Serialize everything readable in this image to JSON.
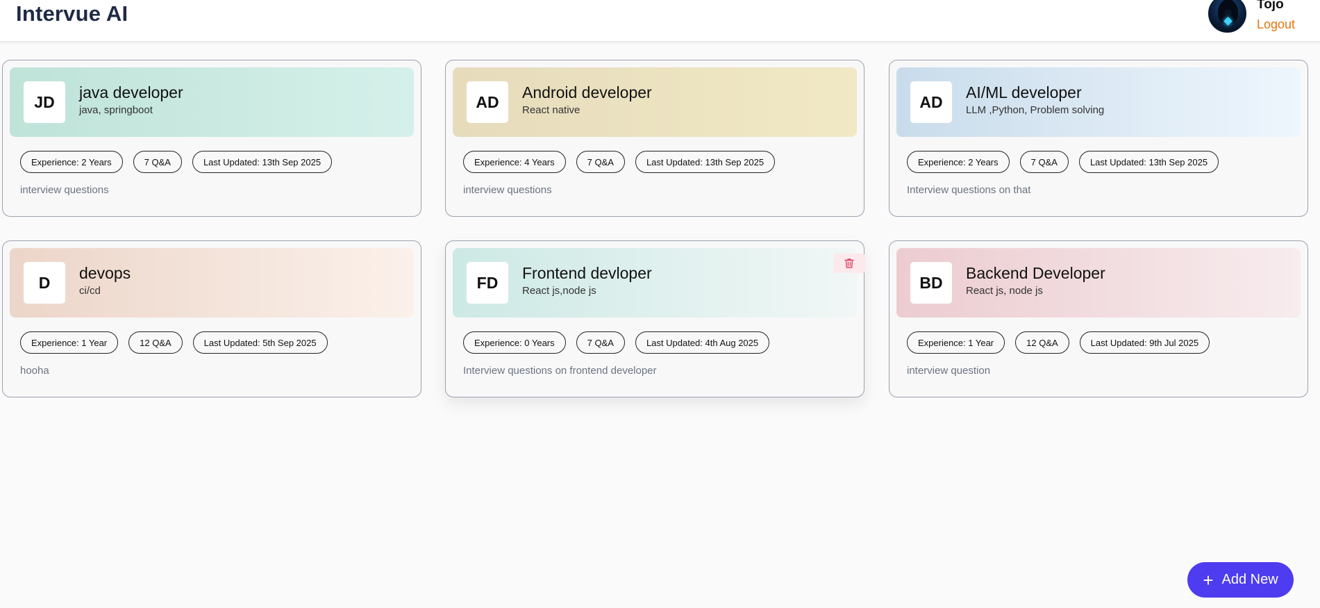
{
  "header": {
    "app_title": "Intervue AI",
    "user_name": "Tojo",
    "logout_label": "Logout"
  },
  "cards": [
    {
      "initials": "JD",
      "title": "java developer",
      "skills": "java, springboot",
      "experience": "Experience: 2 Years",
      "qa": "7 Q&A",
      "updated": "Last Updated: 13th Sep 2025",
      "description": "interview questions",
      "gradient": [
        "#bfe3d8",
        "#d5f0ea"
      ]
    },
    {
      "initials": "AD",
      "title": "Android developer",
      "skills": "React native",
      "experience": "Experience: 4 Years",
      "qa": "7 Q&A",
      "updated": "Last Updated: 13th Sep 2025",
      "description": "interview questions",
      "gradient": [
        "#e6dcbc",
        "#f1e8c5"
      ]
    },
    {
      "initials": "AD",
      "title": "AI/ML developer",
      "skills": "LLM ,Python, Problem solving",
      "experience": "Experience: 2 Years",
      "qa": "7 Q&A",
      "updated": "Last Updated: 13th Sep 2025",
      "description": "Interview questions on that",
      "gradient": [
        "#c9dceb",
        "#eef6fd"
      ]
    },
    {
      "initials": "D",
      "title": "devops",
      "skills": "ci/cd",
      "experience": "Experience: 1 Year",
      "qa": "12 Q&A",
      "updated": "Last Updated: 5th Sep 2025",
      "description": "hooha",
      "gradient": [
        "#ecd5c9",
        "#fbf1ea"
      ]
    },
    {
      "initials": "FD",
      "title": "Frontend devloper",
      "skills": "React js,node js",
      "experience": "Experience: 0 Years",
      "qa": "7 Q&A",
      "updated": "Last Updated: 4th Aug 2025",
      "description": "Interview questions on frontend developer",
      "gradient": [
        "#cde9e5",
        "#f1f7f6"
      ]
    },
    {
      "initials": "BD",
      "title": "Backend Developer",
      "skills": "React js, node js",
      "experience": "Experience: 1 Year",
      "qa": "12 Q&A",
      "updated": "Last Updated: 9th Jul 2025",
      "description": "interview question",
      "gradient": [
        "#ecccd0",
        "#f7ecee"
      ]
    }
  ],
  "add_new": {
    "icon": "plus-icon",
    "label": "Add New"
  },
  "delete_icon": "trash-icon",
  "colors": {
    "brand_title": "#1f2a44",
    "logout": "#e8740c",
    "add_button": "#4d3cf0",
    "delete": "#e0445f"
  }
}
